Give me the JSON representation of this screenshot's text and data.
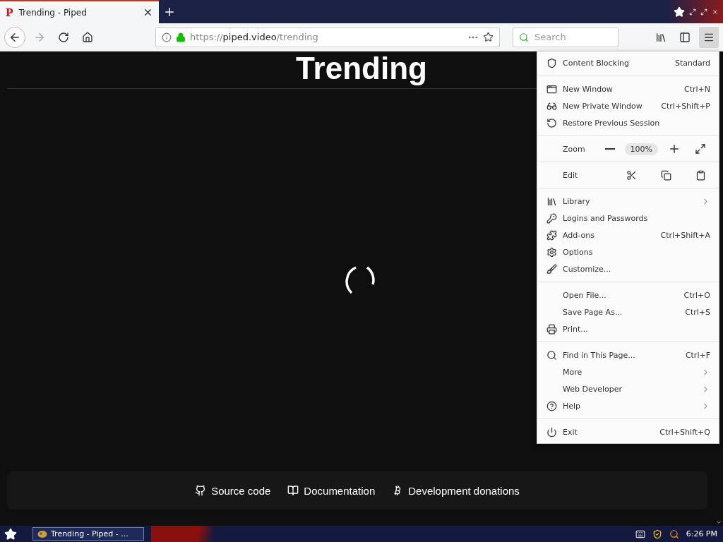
{
  "tab": {
    "favicon": "P",
    "title": "Trending - Piped",
    "selected": true
  },
  "address": {
    "scheme": "https://",
    "host": "piped.video",
    "path": "/trending"
  },
  "search": {
    "placeholder": "Search"
  },
  "page": {
    "heading": "Trending",
    "footer": [
      "Source code",
      "Documentation",
      "Development donations"
    ]
  },
  "menu": {
    "items": [
      {
        "kind": "item",
        "label": "Content Blocking",
        "shortcut": "Standard"
      },
      {
        "kind": "separator"
      },
      {
        "kind": "item",
        "label": "New Window",
        "shortcut": "Ctrl+N"
      },
      {
        "kind": "item",
        "label": "New Private Window",
        "shortcut": "Ctrl+Shift+P"
      },
      {
        "kind": "item",
        "label": "Restore Previous Session"
      },
      {
        "kind": "separator"
      },
      {
        "kind": "zoom",
        "label": "Zoom",
        "value": "100%"
      },
      {
        "kind": "separator"
      },
      {
        "kind": "edit",
        "label": "Edit"
      },
      {
        "kind": "separator"
      },
      {
        "kind": "submenu",
        "label": "Library"
      },
      {
        "kind": "item",
        "label": "Logins and Passwords"
      },
      {
        "kind": "item",
        "label": "Add-ons",
        "shortcut": "Ctrl+Shift+A"
      },
      {
        "kind": "item",
        "label": "Options"
      },
      {
        "kind": "item",
        "label": "Customize..."
      },
      {
        "kind": "separator"
      },
      {
        "kind": "item",
        "label": "Open File...",
        "shortcut": "Ctrl+O"
      },
      {
        "kind": "item",
        "label": "Save Page As...",
        "shortcut": "Ctrl+S"
      },
      {
        "kind": "item",
        "label": "Print..."
      },
      {
        "kind": "separator"
      },
      {
        "kind": "item",
        "label": "Find in This Page...",
        "shortcut": "Ctrl+F"
      },
      {
        "kind": "submenu",
        "label": "More"
      },
      {
        "kind": "submenu",
        "label": "Web Developer"
      },
      {
        "kind": "submenu",
        "label": "Help"
      },
      {
        "kind": "separator"
      },
      {
        "kind": "item",
        "label": "Exit",
        "shortcut": "Ctrl+Shift+Q"
      }
    ]
  },
  "taskbar": {
    "task": "Trending - Piped - ...",
    "time": "6:26 PM"
  }
}
